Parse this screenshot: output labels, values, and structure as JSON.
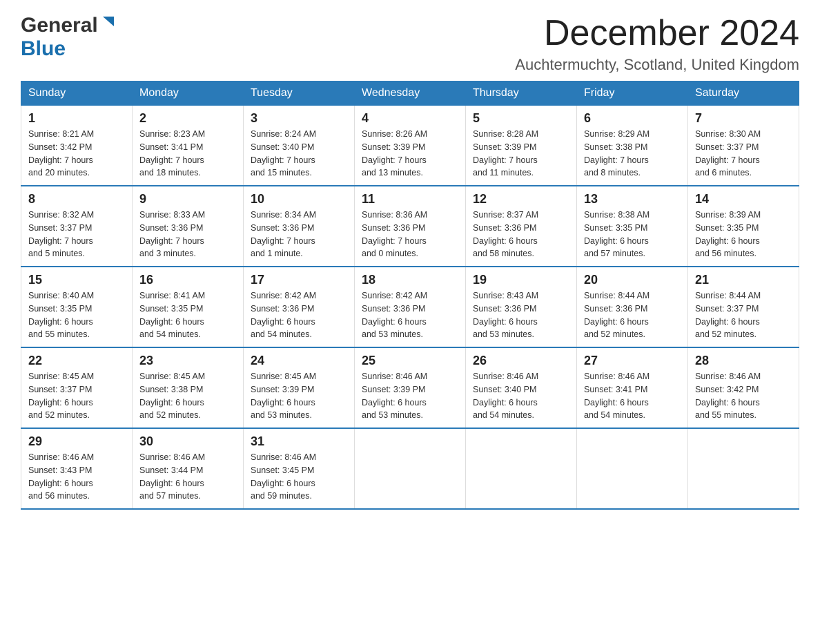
{
  "header": {
    "logo_general": "General",
    "logo_blue": "Blue",
    "month_title": "December 2024",
    "location": "Auchtermuchty, Scotland, United Kingdom"
  },
  "weekdays": [
    "Sunday",
    "Monday",
    "Tuesday",
    "Wednesday",
    "Thursday",
    "Friday",
    "Saturday"
  ],
  "weeks": [
    [
      {
        "day": "1",
        "sunrise": "Sunrise: 8:21 AM",
        "sunset": "Sunset: 3:42 PM",
        "daylight": "Daylight: 7 hours",
        "minutes": "and 20 minutes."
      },
      {
        "day": "2",
        "sunrise": "Sunrise: 8:23 AM",
        "sunset": "Sunset: 3:41 PM",
        "daylight": "Daylight: 7 hours",
        "minutes": "and 18 minutes."
      },
      {
        "day": "3",
        "sunrise": "Sunrise: 8:24 AM",
        "sunset": "Sunset: 3:40 PM",
        "daylight": "Daylight: 7 hours",
        "minutes": "and 15 minutes."
      },
      {
        "day": "4",
        "sunrise": "Sunrise: 8:26 AM",
        "sunset": "Sunset: 3:39 PM",
        "daylight": "Daylight: 7 hours",
        "minutes": "and 13 minutes."
      },
      {
        "day": "5",
        "sunrise": "Sunrise: 8:28 AM",
        "sunset": "Sunset: 3:39 PM",
        "daylight": "Daylight: 7 hours",
        "minutes": "and 11 minutes."
      },
      {
        "day": "6",
        "sunrise": "Sunrise: 8:29 AM",
        "sunset": "Sunset: 3:38 PM",
        "daylight": "Daylight: 7 hours",
        "minutes": "and 8 minutes."
      },
      {
        "day": "7",
        "sunrise": "Sunrise: 8:30 AM",
        "sunset": "Sunset: 3:37 PM",
        "daylight": "Daylight: 7 hours",
        "minutes": "and 6 minutes."
      }
    ],
    [
      {
        "day": "8",
        "sunrise": "Sunrise: 8:32 AM",
        "sunset": "Sunset: 3:37 PM",
        "daylight": "Daylight: 7 hours",
        "minutes": "and 5 minutes."
      },
      {
        "day": "9",
        "sunrise": "Sunrise: 8:33 AM",
        "sunset": "Sunset: 3:36 PM",
        "daylight": "Daylight: 7 hours",
        "minutes": "and 3 minutes."
      },
      {
        "day": "10",
        "sunrise": "Sunrise: 8:34 AM",
        "sunset": "Sunset: 3:36 PM",
        "daylight": "Daylight: 7 hours",
        "minutes": "and 1 minute."
      },
      {
        "day": "11",
        "sunrise": "Sunrise: 8:36 AM",
        "sunset": "Sunset: 3:36 PM",
        "daylight": "Daylight: 7 hours",
        "minutes": "and 0 minutes."
      },
      {
        "day": "12",
        "sunrise": "Sunrise: 8:37 AM",
        "sunset": "Sunset: 3:36 PM",
        "daylight": "Daylight: 6 hours",
        "minutes": "and 58 minutes."
      },
      {
        "day": "13",
        "sunrise": "Sunrise: 8:38 AM",
        "sunset": "Sunset: 3:35 PM",
        "daylight": "Daylight: 6 hours",
        "minutes": "and 57 minutes."
      },
      {
        "day": "14",
        "sunrise": "Sunrise: 8:39 AM",
        "sunset": "Sunset: 3:35 PM",
        "daylight": "Daylight: 6 hours",
        "minutes": "and 56 minutes."
      }
    ],
    [
      {
        "day": "15",
        "sunrise": "Sunrise: 8:40 AM",
        "sunset": "Sunset: 3:35 PM",
        "daylight": "Daylight: 6 hours",
        "minutes": "and 55 minutes."
      },
      {
        "day": "16",
        "sunrise": "Sunrise: 8:41 AM",
        "sunset": "Sunset: 3:35 PM",
        "daylight": "Daylight: 6 hours",
        "minutes": "and 54 minutes."
      },
      {
        "day": "17",
        "sunrise": "Sunrise: 8:42 AM",
        "sunset": "Sunset: 3:36 PM",
        "daylight": "Daylight: 6 hours",
        "minutes": "and 54 minutes."
      },
      {
        "day": "18",
        "sunrise": "Sunrise: 8:42 AM",
        "sunset": "Sunset: 3:36 PM",
        "daylight": "Daylight: 6 hours",
        "minutes": "and 53 minutes."
      },
      {
        "day": "19",
        "sunrise": "Sunrise: 8:43 AM",
        "sunset": "Sunset: 3:36 PM",
        "daylight": "Daylight: 6 hours",
        "minutes": "and 53 minutes."
      },
      {
        "day": "20",
        "sunrise": "Sunrise: 8:44 AM",
        "sunset": "Sunset: 3:36 PM",
        "daylight": "Daylight: 6 hours",
        "minutes": "and 52 minutes."
      },
      {
        "day": "21",
        "sunrise": "Sunrise: 8:44 AM",
        "sunset": "Sunset: 3:37 PM",
        "daylight": "Daylight: 6 hours",
        "minutes": "and 52 minutes."
      }
    ],
    [
      {
        "day": "22",
        "sunrise": "Sunrise: 8:45 AM",
        "sunset": "Sunset: 3:37 PM",
        "daylight": "Daylight: 6 hours",
        "minutes": "and 52 minutes."
      },
      {
        "day": "23",
        "sunrise": "Sunrise: 8:45 AM",
        "sunset": "Sunset: 3:38 PM",
        "daylight": "Daylight: 6 hours",
        "minutes": "and 52 minutes."
      },
      {
        "day": "24",
        "sunrise": "Sunrise: 8:45 AM",
        "sunset": "Sunset: 3:39 PM",
        "daylight": "Daylight: 6 hours",
        "minutes": "and 53 minutes."
      },
      {
        "day": "25",
        "sunrise": "Sunrise: 8:46 AM",
        "sunset": "Sunset: 3:39 PM",
        "daylight": "Daylight: 6 hours",
        "minutes": "and 53 minutes."
      },
      {
        "day": "26",
        "sunrise": "Sunrise: 8:46 AM",
        "sunset": "Sunset: 3:40 PM",
        "daylight": "Daylight: 6 hours",
        "minutes": "and 54 minutes."
      },
      {
        "day": "27",
        "sunrise": "Sunrise: 8:46 AM",
        "sunset": "Sunset: 3:41 PM",
        "daylight": "Daylight: 6 hours",
        "minutes": "and 54 minutes."
      },
      {
        "day": "28",
        "sunrise": "Sunrise: 8:46 AM",
        "sunset": "Sunset: 3:42 PM",
        "daylight": "Daylight: 6 hours",
        "minutes": "and 55 minutes."
      }
    ],
    [
      {
        "day": "29",
        "sunrise": "Sunrise: 8:46 AM",
        "sunset": "Sunset: 3:43 PM",
        "daylight": "Daylight: 6 hours",
        "minutes": "and 56 minutes."
      },
      {
        "day": "30",
        "sunrise": "Sunrise: 8:46 AM",
        "sunset": "Sunset: 3:44 PM",
        "daylight": "Daylight: 6 hours",
        "minutes": "and 57 minutes."
      },
      {
        "day": "31",
        "sunrise": "Sunrise: 8:46 AM",
        "sunset": "Sunset: 3:45 PM",
        "daylight": "Daylight: 6 hours",
        "minutes": "and 59 minutes."
      },
      null,
      null,
      null,
      null
    ]
  ]
}
